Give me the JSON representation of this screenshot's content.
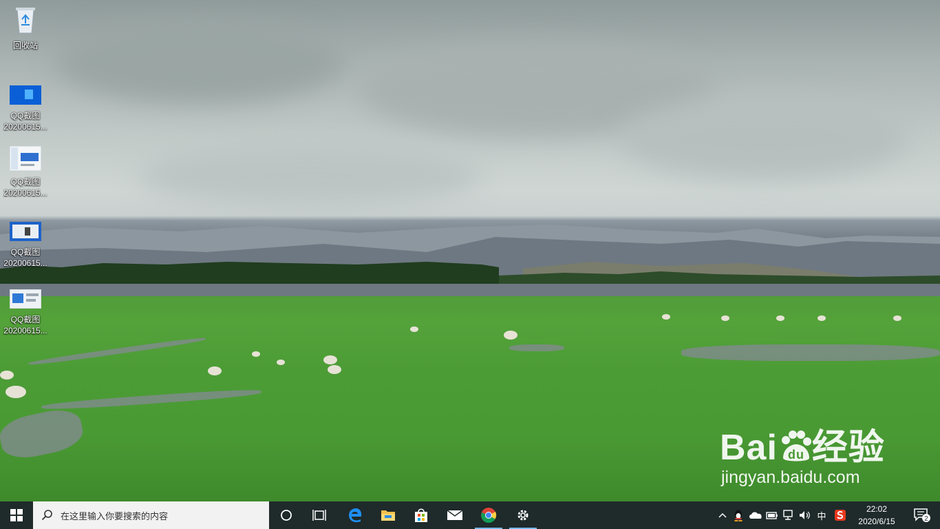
{
  "desktop": {
    "icons": [
      {
        "line1": "回收站",
        "line2": "",
        "type": "recycle-bin"
      },
      {
        "line1": "QQ截图",
        "line2": "20200615...",
        "type": "screenshot"
      },
      {
        "line1": "QQ截图",
        "line2": "20200615...",
        "type": "screenshot"
      },
      {
        "line1": "QQ截图",
        "line2": "20200615...",
        "type": "screenshot"
      },
      {
        "line1": "QQ截图",
        "line2": "20200615...",
        "type": "screenshot"
      }
    ],
    "watermark": {
      "brand_a": "Bai",
      "brand_b": "du",
      "brand_c": "经验",
      "url": "jingyan.baidu.com"
    }
  },
  "taskbar": {
    "search_placeholder": "在这里输入你要搜索的内容",
    "pinned": [
      "cortana-icon",
      "task-view-icon",
      "edge-icon",
      "file-explorer-icon",
      "store-icon",
      "mail-icon",
      "chrome-icon",
      "settings-icon"
    ],
    "tray": {
      "ime": "中",
      "time": "22:02",
      "date": "2020/6/15",
      "notifications": "2"
    }
  },
  "colors": {
    "taskbar": "#1f2a2a",
    "accent": "#76b9ed",
    "grass": "#4f9a3a",
    "sky": "#c3cbc9"
  }
}
